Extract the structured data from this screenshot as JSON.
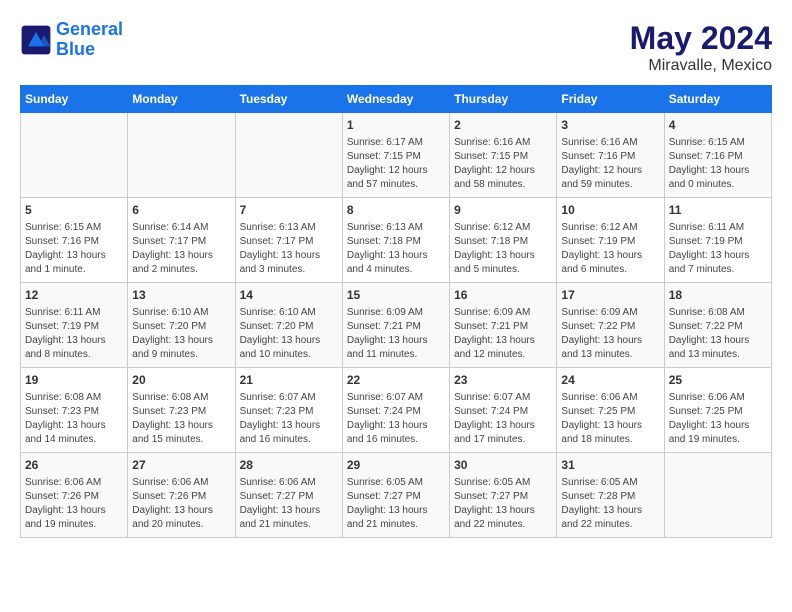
{
  "logo": {
    "line1": "General",
    "line2": "Blue"
  },
  "title": "May 2024",
  "subtitle": "Miravalle, Mexico",
  "weekdays": [
    "Sunday",
    "Monday",
    "Tuesday",
    "Wednesday",
    "Thursday",
    "Friday",
    "Saturday"
  ],
  "weeks": [
    [
      {
        "day": "",
        "content": ""
      },
      {
        "day": "",
        "content": ""
      },
      {
        "day": "",
        "content": ""
      },
      {
        "day": "1",
        "content": "Sunrise: 6:17 AM\nSunset: 7:15 PM\nDaylight: 12 hours\nand 57 minutes."
      },
      {
        "day": "2",
        "content": "Sunrise: 6:16 AM\nSunset: 7:15 PM\nDaylight: 12 hours\nand 58 minutes."
      },
      {
        "day": "3",
        "content": "Sunrise: 6:16 AM\nSunset: 7:16 PM\nDaylight: 12 hours\nand 59 minutes."
      },
      {
        "day": "4",
        "content": "Sunrise: 6:15 AM\nSunset: 7:16 PM\nDaylight: 13 hours\nand 0 minutes."
      }
    ],
    [
      {
        "day": "5",
        "content": "Sunrise: 6:15 AM\nSunset: 7:16 PM\nDaylight: 13 hours\nand 1 minute."
      },
      {
        "day": "6",
        "content": "Sunrise: 6:14 AM\nSunset: 7:17 PM\nDaylight: 13 hours\nand 2 minutes."
      },
      {
        "day": "7",
        "content": "Sunrise: 6:13 AM\nSunset: 7:17 PM\nDaylight: 13 hours\nand 3 minutes."
      },
      {
        "day": "8",
        "content": "Sunrise: 6:13 AM\nSunset: 7:18 PM\nDaylight: 13 hours\nand 4 minutes."
      },
      {
        "day": "9",
        "content": "Sunrise: 6:12 AM\nSunset: 7:18 PM\nDaylight: 13 hours\nand 5 minutes."
      },
      {
        "day": "10",
        "content": "Sunrise: 6:12 AM\nSunset: 7:19 PM\nDaylight: 13 hours\nand 6 minutes."
      },
      {
        "day": "11",
        "content": "Sunrise: 6:11 AM\nSunset: 7:19 PM\nDaylight: 13 hours\nand 7 minutes."
      }
    ],
    [
      {
        "day": "12",
        "content": "Sunrise: 6:11 AM\nSunset: 7:19 PM\nDaylight: 13 hours\nand 8 minutes."
      },
      {
        "day": "13",
        "content": "Sunrise: 6:10 AM\nSunset: 7:20 PM\nDaylight: 13 hours\nand 9 minutes."
      },
      {
        "day": "14",
        "content": "Sunrise: 6:10 AM\nSunset: 7:20 PM\nDaylight: 13 hours\nand 10 minutes."
      },
      {
        "day": "15",
        "content": "Sunrise: 6:09 AM\nSunset: 7:21 PM\nDaylight: 13 hours\nand 11 minutes."
      },
      {
        "day": "16",
        "content": "Sunrise: 6:09 AM\nSunset: 7:21 PM\nDaylight: 13 hours\nand 12 minutes."
      },
      {
        "day": "17",
        "content": "Sunrise: 6:09 AM\nSunset: 7:22 PM\nDaylight: 13 hours\nand 13 minutes."
      },
      {
        "day": "18",
        "content": "Sunrise: 6:08 AM\nSunset: 7:22 PM\nDaylight: 13 hours\nand 13 minutes."
      }
    ],
    [
      {
        "day": "19",
        "content": "Sunrise: 6:08 AM\nSunset: 7:23 PM\nDaylight: 13 hours\nand 14 minutes."
      },
      {
        "day": "20",
        "content": "Sunrise: 6:08 AM\nSunset: 7:23 PM\nDaylight: 13 hours\nand 15 minutes."
      },
      {
        "day": "21",
        "content": "Sunrise: 6:07 AM\nSunset: 7:23 PM\nDaylight: 13 hours\nand 16 minutes."
      },
      {
        "day": "22",
        "content": "Sunrise: 6:07 AM\nSunset: 7:24 PM\nDaylight: 13 hours\nand 16 minutes."
      },
      {
        "day": "23",
        "content": "Sunrise: 6:07 AM\nSunset: 7:24 PM\nDaylight: 13 hours\nand 17 minutes."
      },
      {
        "day": "24",
        "content": "Sunrise: 6:06 AM\nSunset: 7:25 PM\nDaylight: 13 hours\nand 18 minutes."
      },
      {
        "day": "25",
        "content": "Sunrise: 6:06 AM\nSunset: 7:25 PM\nDaylight: 13 hours\nand 19 minutes."
      }
    ],
    [
      {
        "day": "26",
        "content": "Sunrise: 6:06 AM\nSunset: 7:26 PM\nDaylight: 13 hours\nand 19 minutes."
      },
      {
        "day": "27",
        "content": "Sunrise: 6:06 AM\nSunset: 7:26 PM\nDaylight: 13 hours\nand 20 minutes."
      },
      {
        "day": "28",
        "content": "Sunrise: 6:06 AM\nSunset: 7:27 PM\nDaylight: 13 hours\nand 21 minutes."
      },
      {
        "day": "29",
        "content": "Sunrise: 6:05 AM\nSunset: 7:27 PM\nDaylight: 13 hours\nand 21 minutes."
      },
      {
        "day": "30",
        "content": "Sunrise: 6:05 AM\nSunset: 7:27 PM\nDaylight: 13 hours\nand 22 minutes."
      },
      {
        "day": "31",
        "content": "Sunrise: 6:05 AM\nSunset: 7:28 PM\nDaylight: 13 hours\nand 22 minutes."
      },
      {
        "day": "",
        "content": ""
      }
    ]
  ]
}
